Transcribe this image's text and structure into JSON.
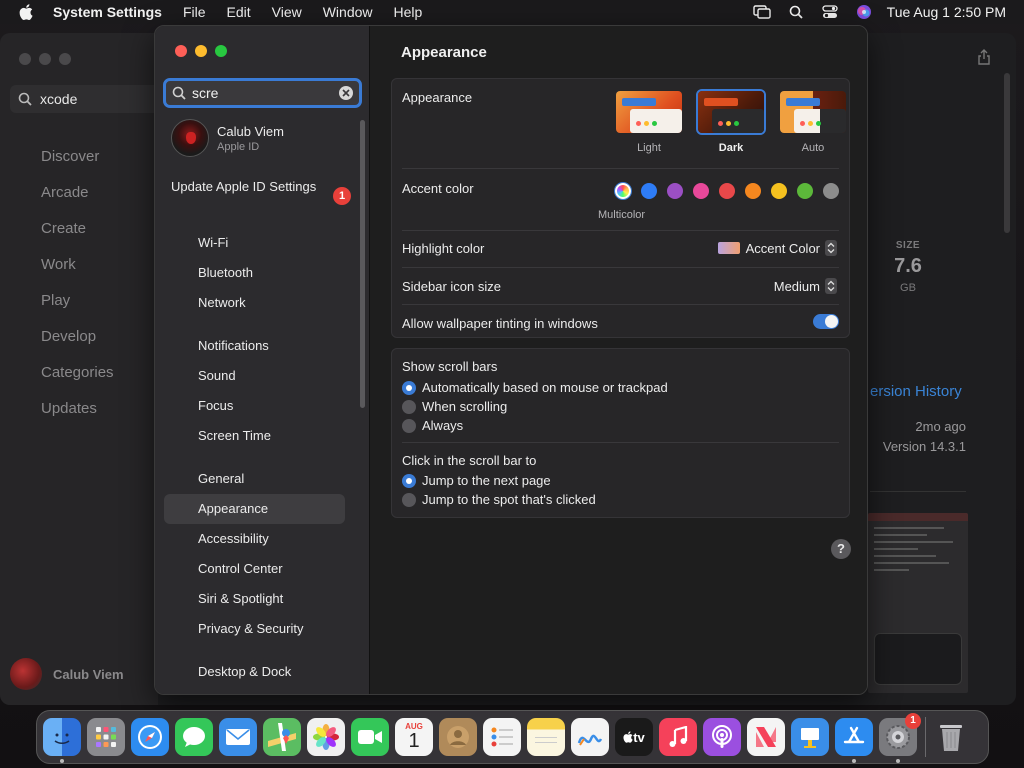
{
  "menubar": {
    "app_name": "System Settings",
    "menus": [
      "File",
      "Edit",
      "View",
      "Window",
      "Help"
    ],
    "clock": "Tue Aug 1  2:50 PM",
    "icons": [
      "screen-mirroring-icon",
      "search-icon",
      "control-center-icon",
      "siri-icon"
    ]
  },
  "background_window": {
    "search_value": "xcode",
    "nav": [
      "Discover",
      "Arcade",
      "Create",
      "Work",
      "Play",
      "Develop",
      "Categories",
      "Updates"
    ],
    "user_name": "Calub Viem",
    "size_label": "SIZE",
    "size_value": "7.6",
    "size_unit": "GB",
    "version_history": "ersion History",
    "updated_ago": "2mo ago",
    "version": "Version 14.3.1"
  },
  "sidebar": {
    "search_value": "scre",
    "account_name": "Calub Viem",
    "account_sub": "Apple ID",
    "update_label": "Update Apple ID Settings",
    "update_badge": "1",
    "group1": [
      "Wi-Fi",
      "Bluetooth",
      "Network"
    ],
    "group2": [
      "Notifications",
      "Sound",
      "Focus",
      "Screen Time"
    ],
    "group3": [
      "General",
      "Appearance",
      "Accessibility",
      "Control Center",
      "Siri & Spotlight",
      "Privacy & Security"
    ],
    "group4": [
      "Desktop & Dock"
    ],
    "selected": "Appearance"
  },
  "content": {
    "title": "Appearance",
    "appearance_label": "Appearance",
    "appearance_options": [
      "Light",
      "Dark",
      "Auto"
    ],
    "appearance_selected": "Dark",
    "accent_label": "Accent color",
    "accent_caption": "Multicolor",
    "accent_colors": [
      "multicolor",
      "#2e7cf6",
      "#9b4fc4",
      "#e8489a",
      "#e8484a",
      "#f5871f",
      "#f5c11f",
      "#5cb83a",
      "#8c8c8c"
    ],
    "highlight_label": "Highlight color",
    "highlight_value": "Accent Color",
    "sidebar_icon_label": "Sidebar icon size",
    "sidebar_icon_value": "Medium",
    "tinting_label": "Allow wallpaper tinting in windows",
    "tinting_on": true,
    "scroll_bars_label": "Show scroll bars",
    "scroll_options": [
      "Automatically based on mouse or trackpad",
      "When scrolling",
      "Always"
    ],
    "scroll_selected": 0,
    "click_label": "Click in the scroll bar to",
    "click_options": [
      "Jump to the next page",
      "Jump to the spot that's clicked"
    ],
    "click_selected": 0,
    "help": "?"
  },
  "dock": {
    "apps": [
      {
        "name": "finder",
        "color": "#3a8ee8"
      },
      {
        "name": "launchpad",
        "color": "#8a8a8e"
      },
      {
        "name": "safari",
        "color": "#2d8cf0"
      },
      {
        "name": "messages",
        "color": "#34c759"
      },
      {
        "name": "mail",
        "color": "#3a8ee8"
      },
      {
        "name": "maps",
        "color": "#5bbd62"
      },
      {
        "name": "photos",
        "color": "#f0f0f0"
      },
      {
        "name": "facetime",
        "color": "#34c759"
      },
      {
        "name": "calendar",
        "color": "#f4f4f4"
      },
      {
        "name": "contacts",
        "color": "#b08a5a"
      },
      {
        "name": "reminders",
        "color": "#f4f4f4"
      },
      {
        "name": "notes",
        "color": "#f7d14a"
      },
      {
        "name": "freeform",
        "color": "#f4f4f4"
      },
      {
        "name": "tv",
        "color": "#1a1a1a"
      },
      {
        "name": "music",
        "color": "#f5415a"
      },
      {
        "name": "podcasts",
        "color": "#9b4fe0"
      },
      {
        "name": "news",
        "color": "#f4f4f4"
      },
      {
        "name": "keynote",
        "color": "#3a8ee8"
      },
      {
        "name": "app-store",
        "color": "#2d8cf0"
      },
      {
        "name": "system-settings",
        "color": "#7a7a7e"
      }
    ],
    "calendar_month": "AUG",
    "calendar_day": "1",
    "tv_label": "tv",
    "settings_badge": "1"
  }
}
